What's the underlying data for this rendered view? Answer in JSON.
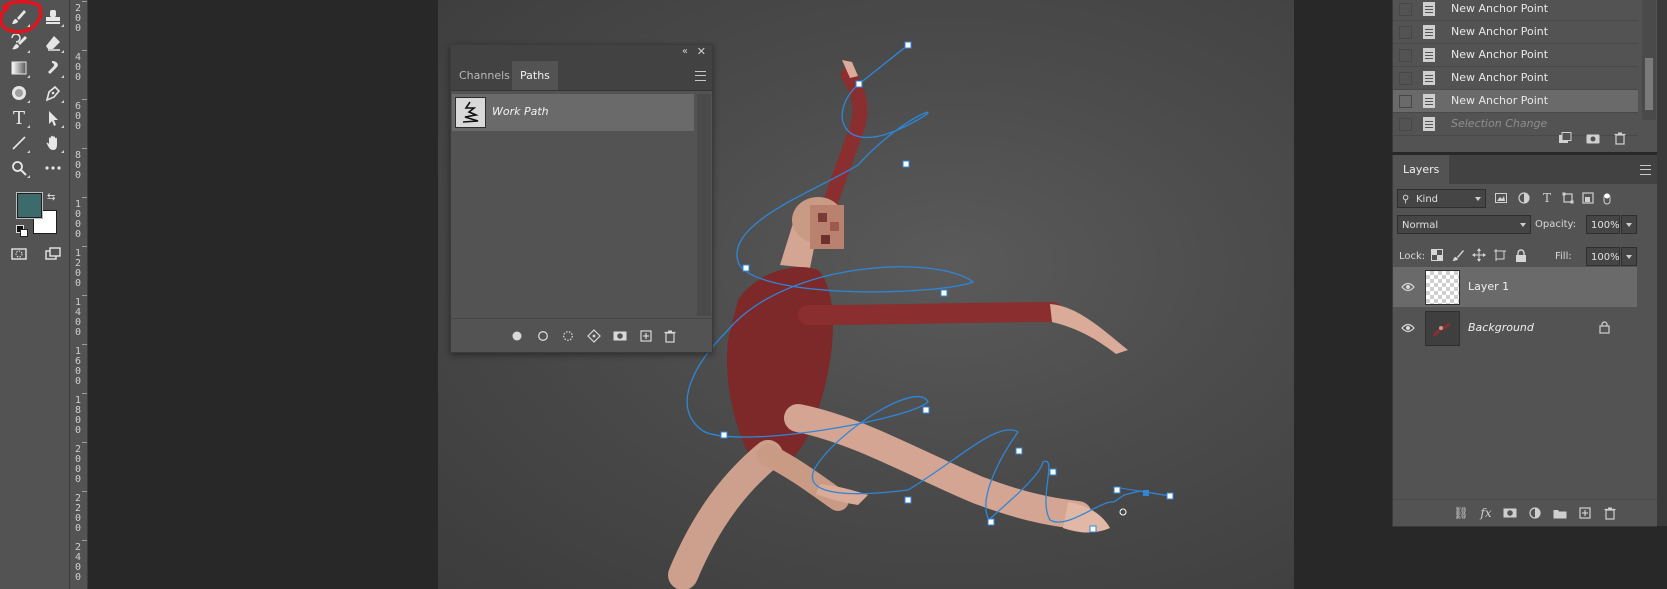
{
  "toolbar": {
    "tools": [
      {
        "icon": "brush-icon",
        "active": true
      },
      {
        "icon": "clone-stamp-icon"
      },
      {
        "icon": "history-brush-icon"
      },
      {
        "icon": "eraser-icon"
      },
      {
        "icon": "gradient-icon"
      },
      {
        "icon": "smudge-icon"
      },
      {
        "icon": "burn-icon"
      },
      {
        "icon": "pen-icon"
      },
      {
        "icon": "type-icon"
      },
      {
        "icon": "path-selection-icon"
      },
      {
        "icon": "line-icon"
      },
      {
        "icon": "hand-icon"
      },
      {
        "icon": "zoom-icon"
      },
      {
        "icon": "more-tools-icon"
      }
    ],
    "type_tool_glyph": "T",
    "foreground_color": "#3d6b6c",
    "background_color": "#ffffff",
    "annotation_color": "#e0141e"
  },
  "ruler": {
    "labels": [
      "200",
      "400",
      "600",
      "800",
      "1000",
      "1200",
      "1400",
      "1600",
      "1800",
      "2000",
      "2200",
      "2400"
    ]
  },
  "paths_panel": {
    "tabs": [
      "Channels",
      "Paths"
    ],
    "active_tab": "Paths",
    "paths": [
      {
        "name": "Work Path"
      }
    ],
    "footer_buttons": [
      "fill-path-icon",
      "stroke-path-icon",
      "load-selection-icon",
      "make-work-path-icon",
      "add-mask-icon",
      "new-path-icon",
      "delete-icon"
    ]
  },
  "history": {
    "items": [
      {
        "label": "New Anchor Point",
        "selected": false,
        "dim": false
      },
      {
        "label": "New Anchor Point",
        "selected": false,
        "dim": false
      },
      {
        "label": "New Anchor Point",
        "selected": false,
        "dim": false
      },
      {
        "label": "New Anchor Point",
        "selected": false,
        "dim": false
      },
      {
        "label": "New Anchor Point",
        "selected": true,
        "dim": false
      },
      {
        "label": "Selection Change",
        "selected": false,
        "dim": true
      }
    ],
    "footer_buttons": [
      "new-document-from-state-icon",
      "camera-icon",
      "delete-icon"
    ]
  },
  "layers": {
    "tab": "Layers",
    "filter_kind": "Kind",
    "blend_mode": "Normal",
    "opacity_label": "Opacity:",
    "opacity_value": "100%",
    "lock_label": "Lock:",
    "fill_label": "Fill:",
    "fill_value": "100%",
    "rows": [
      {
        "name": "Layer 1",
        "selected": true,
        "italic": false,
        "locked": false
      },
      {
        "name": "Background",
        "selected": false,
        "italic": true,
        "locked": true
      }
    ],
    "footer_buttons": [
      "link-icon",
      "fx-icon",
      "mask-icon",
      "adjustment-icon",
      "folder-icon",
      "new-layer-icon",
      "delete-icon"
    ],
    "fx_label": "fx"
  },
  "canvas": {
    "path_color": "#2f86d8"
  }
}
